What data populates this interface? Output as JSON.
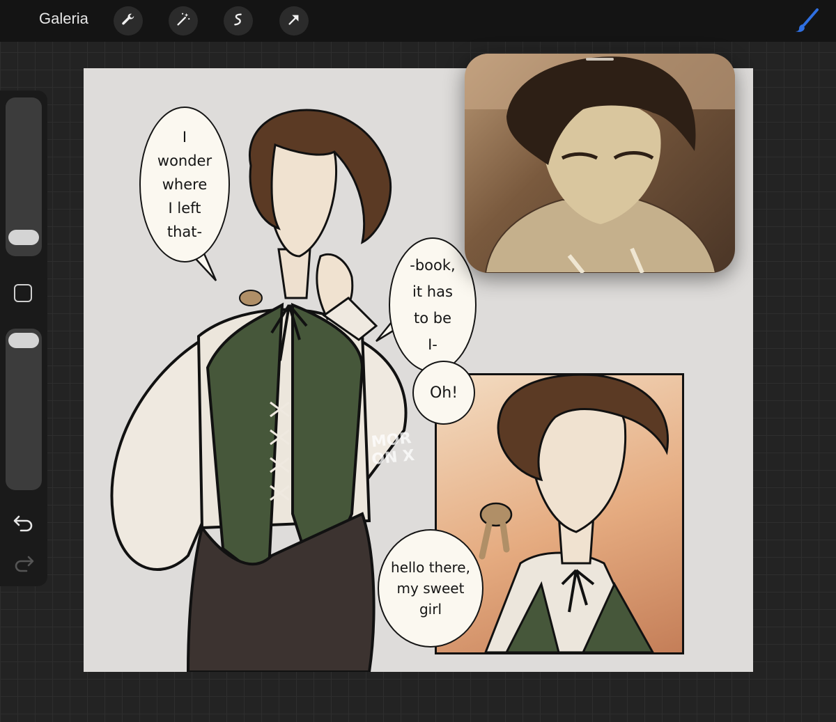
{
  "topbar": {
    "gallery_label": "Galeria",
    "tools": [
      "wrench-icon",
      "magic-wand-icon",
      "selection-icon",
      "transform-arrow-icon"
    ],
    "active_tool": "brush-icon",
    "accent_color": "#2f6fe0"
  },
  "sidebar": {
    "tools": [
      "brush-size-slider",
      "modify-button",
      "opacity-slider",
      "undo-icon",
      "redo-icon"
    ]
  },
  "canvas": {
    "background": "#dedcda",
    "bubbles": {
      "first": "I\nwonder\nwhere\nI left\nthat-",
      "second": "-book,\nit has\nto be\nI-",
      "third": "Oh!",
      "fourth": "hello there,\nmy sweet\ngirl"
    },
    "watermark": "MOR ON X"
  },
  "reference_window": {
    "content": "character reference portrait"
  }
}
